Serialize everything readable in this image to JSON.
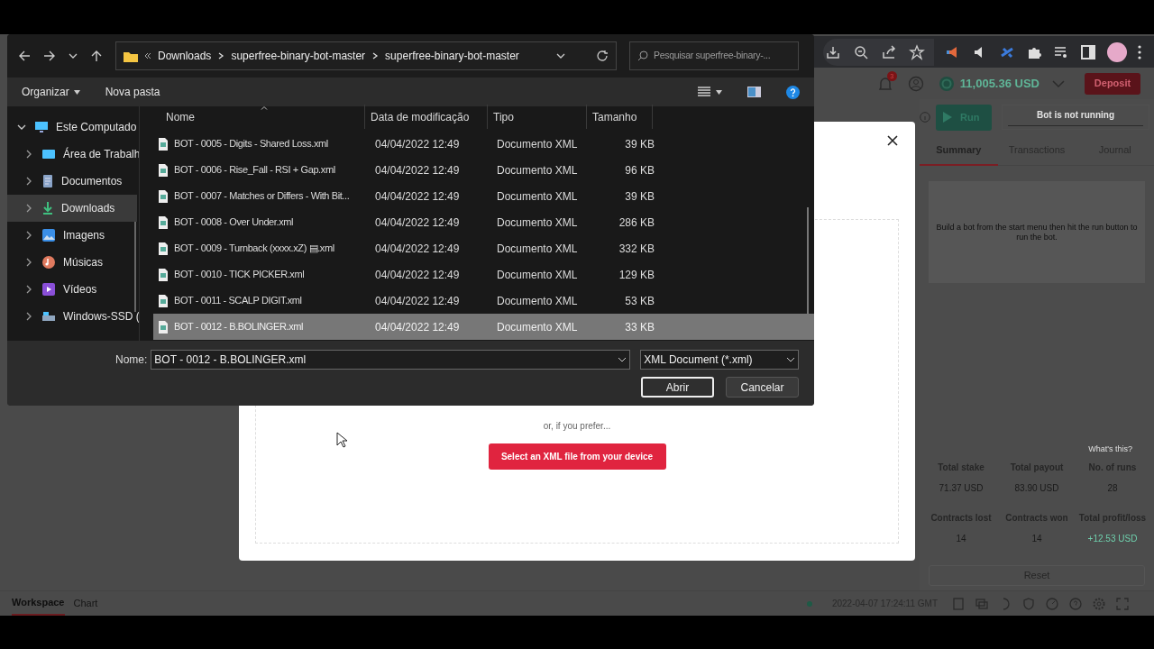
{
  "app_header": {
    "notification_count": "3",
    "balance": "11,005.36 USD",
    "deposit": "Deposit"
  },
  "run_panel": {
    "run_button": "Run",
    "status": "Bot is not running"
  },
  "tabs": [
    {
      "label": "Summary",
      "selected": true
    },
    {
      "label": "Transactions",
      "selected": false
    },
    {
      "label": "Journal",
      "selected": false
    }
  ],
  "summary_message": "Build a bot from the start menu then hit the run button to run the bot.",
  "stats": {
    "whats_this": "What's this?",
    "items": [
      {
        "label": "Total stake",
        "value": "71.37 USD",
        "positive": false
      },
      {
        "label": "Total payout",
        "value": "83.90 USD",
        "positive": false
      },
      {
        "label": "No. of runs",
        "value": "28",
        "positive": false
      },
      {
        "label": "Contracts lost",
        "value": "14",
        "positive": false
      },
      {
        "label": "Contracts won",
        "value": "14",
        "positive": false
      },
      {
        "label": "Total profit/loss",
        "value": "+12.53 USD",
        "positive": true
      }
    ]
  },
  "reset": "Reset",
  "footer": {
    "tabs": [
      {
        "label": "Workspace",
        "selected": true
      },
      {
        "label": "Chart",
        "selected": false
      }
    ],
    "timestamp": "2022-04-07 17:24:11 GMT"
  },
  "modal": {
    "prompt": "or, if you prefer...",
    "select_button": "Select an XML file from your device"
  },
  "file_dialog": {
    "path": [
      "Downloads",
      "superfree-binary-bot-master",
      "superfree-binary-bot-master"
    ],
    "search_placeholder": "Pesquisar superfree-binary-...",
    "organize": "Organizar",
    "new_folder": "Nova pasta",
    "nav": [
      {
        "label": "Este Computado",
        "kind": "computer",
        "expanded": true,
        "selected": false,
        "children": [
          {
            "label": "Área de Trabalh",
            "kind": "desktop",
            "expanded": false,
            "selected": false
          },
          {
            "label": "Documentos",
            "kind": "documents",
            "expanded": false,
            "selected": false
          },
          {
            "label": "Downloads",
            "kind": "downloads",
            "expanded": false,
            "selected": true
          },
          {
            "label": "Imagens",
            "kind": "pictures",
            "expanded": false,
            "selected": false
          },
          {
            "label": "Músicas",
            "kind": "music",
            "expanded": false,
            "selected": false
          },
          {
            "label": "Vídeos",
            "kind": "videos",
            "expanded": false,
            "selected": false
          },
          {
            "label": "Windows-SSD (",
            "kind": "drive",
            "expanded": false,
            "selected": false
          }
        ]
      }
    ],
    "columns": [
      "Nome",
      "Data de modificação",
      "Tipo",
      "Tamanho"
    ],
    "files": [
      {
        "name": "BOT - 0005 - Digits - Shared Loss.xml",
        "date": "04/04/2022 12:49",
        "type": "Documento XML",
        "size": "39 KB",
        "selected": false
      },
      {
        "name": "BOT - 0006 - Rise_Fall - RSI + Gap.xml",
        "date": "04/04/2022 12:49",
        "type": "Documento XML",
        "size": "96 KB",
        "selected": false
      },
      {
        "name": "BOT - 0007 - Matches or Differs - With Bit...",
        "date": "04/04/2022 12:49",
        "type": "Documento XML",
        "size": "39 KB",
        "selected": false
      },
      {
        "name": "BOT - 0008 - Over Under.xml",
        "date": "04/04/2022 12:49",
        "type": "Documento XML",
        "size": "286 KB",
        "selected": false
      },
      {
        "name": "BOT - 0009 - Turnback (xxxx.xZ) ▤.xml",
        "date": "04/04/2022 12:49",
        "type": "Documento XML",
        "size": "332 KB",
        "selected": false
      },
      {
        "name": "BOT - 0010 -  TICK PICKER.xml",
        "date": "04/04/2022 12:49",
        "type": "Documento XML",
        "size": "129 KB",
        "selected": false
      },
      {
        "name": "BOT - 0011 - SCALP DIGIT.xml",
        "date": "04/04/2022 12:49",
        "type": "Documento XML",
        "size": "53 KB",
        "selected": false
      },
      {
        "name": "BOT - 0012 - B.BOLINGER.xml",
        "date": "04/04/2022 12:49",
        "type": "Documento XML",
        "size": "33 KB",
        "selected": true
      }
    ],
    "name_label": "Nome:",
    "file_name": "BOT - 0012 - B.BOLINGER.xml",
    "file_type": "XML Document (*.xml)",
    "open": "Abrir",
    "cancel": "Cancelar"
  }
}
